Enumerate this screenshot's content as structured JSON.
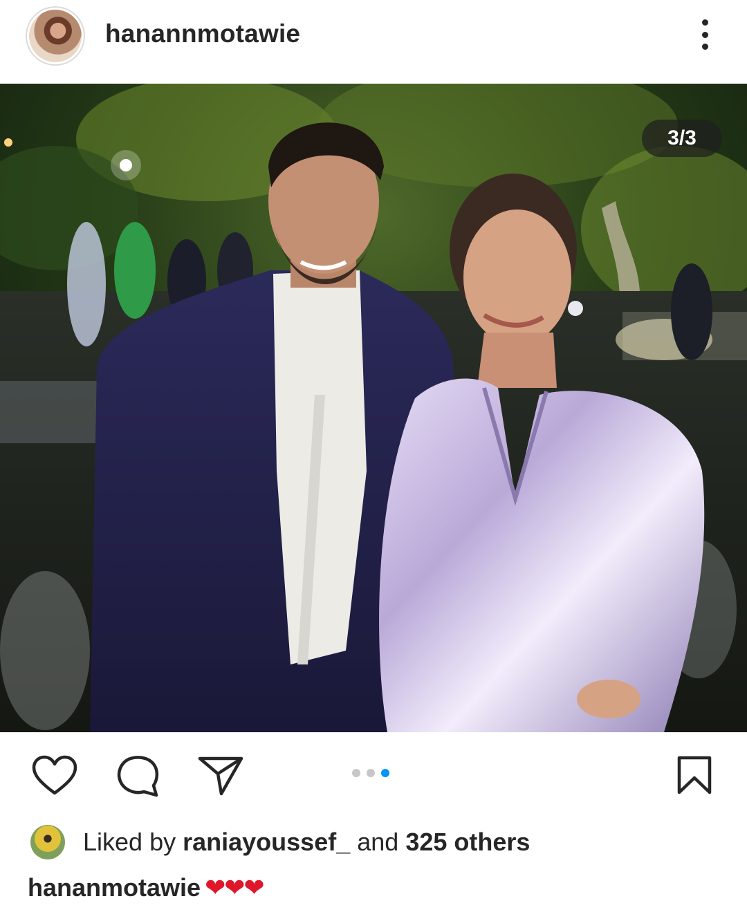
{
  "post": {
    "username": "hanannmotawie",
    "media_counter": "3/3",
    "carousel": {
      "total": 3,
      "active_index": 3
    },
    "likes": {
      "prefix": "Liked by",
      "liker": "raniayoussef_",
      "joiner": "and",
      "others": "325 others"
    },
    "caption": {
      "username": "hananmotawie",
      "text": "❤❤❤"
    }
  },
  "icons": {
    "menu": "more-vertical-icon",
    "like": "heart-icon",
    "comment": "comment-icon",
    "share": "send-icon",
    "save": "bookmark-icon"
  },
  "colors": {
    "text": "#262626",
    "accent_blue": "#0095f6",
    "dot_inactive": "#c7c7c7",
    "heart_red": "#e0162b"
  }
}
